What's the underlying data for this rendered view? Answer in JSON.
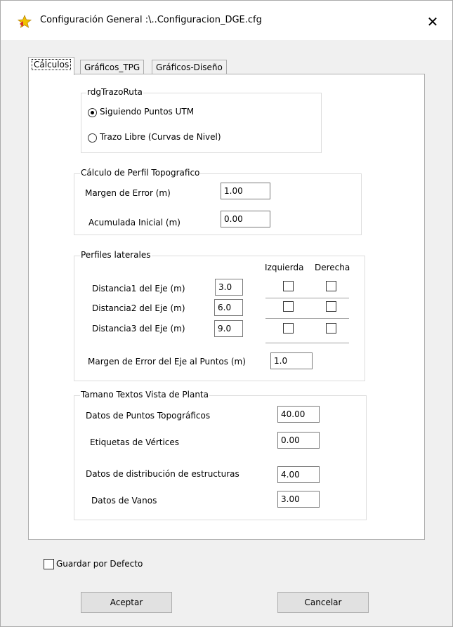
{
  "window": {
    "title": "Configuración General :\\..Configuracion_DGE.cfg",
    "close_glyph": "✕"
  },
  "tabs": [
    {
      "label": "Cálculos",
      "active": true
    },
    {
      "label": "Gráficos_TPG",
      "active": false
    },
    {
      "label": "Gráficos-Diseño",
      "active": false
    }
  ],
  "trazo": {
    "legend": "rdgTrazoRuta",
    "option1": "Siguiendo Puntos UTM",
    "option2": "Trazo Libre (Curvas de Nivel)",
    "selected": "option1"
  },
  "perfil": {
    "legend": "Cálculo de Perfil Topografico",
    "margen_label": "Margen de Error (m)",
    "margen_value": "1.00",
    "acumulada_label": "Acumulada Inicial (m)",
    "acumulada_value": "0.00"
  },
  "laterales": {
    "legend": "Perfiles laterales",
    "col_izquierda": "Izquierda",
    "col_derecha": "Derecha",
    "dist1_label": "Distancia1 del Eje (m)",
    "dist1_value": "3.0",
    "dist2_label": "Distancia2 del Eje (m)",
    "dist2_value": "6.0",
    "dist3_label": "Distancia3 del Eje (m)",
    "dist3_value": "9.0",
    "margen_eje_label": "Margen de Error del Eje al Puntos (m)",
    "margen_eje_value": "1.0"
  },
  "textos": {
    "legend": "Tamano Textos Vista de Planta",
    "puntos_label": "Datos de Puntos Topográficos",
    "puntos_value": "40.00",
    "etiquetas_label": "Etiquetas de Vértices",
    "etiquetas_value": "0.00",
    "estructuras_label": "Datos de distribución de estructuras",
    "estructuras_value": "4.00",
    "vanos_label": "Datos de Vanos",
    "vanos_value": "3.00"
  },
  "footer": {
    "guardar_label": "Guardar por Defecto",
    "aceptar_label": "Aceptar",
    "cancelar_label": "Cancelar"
  }
}
